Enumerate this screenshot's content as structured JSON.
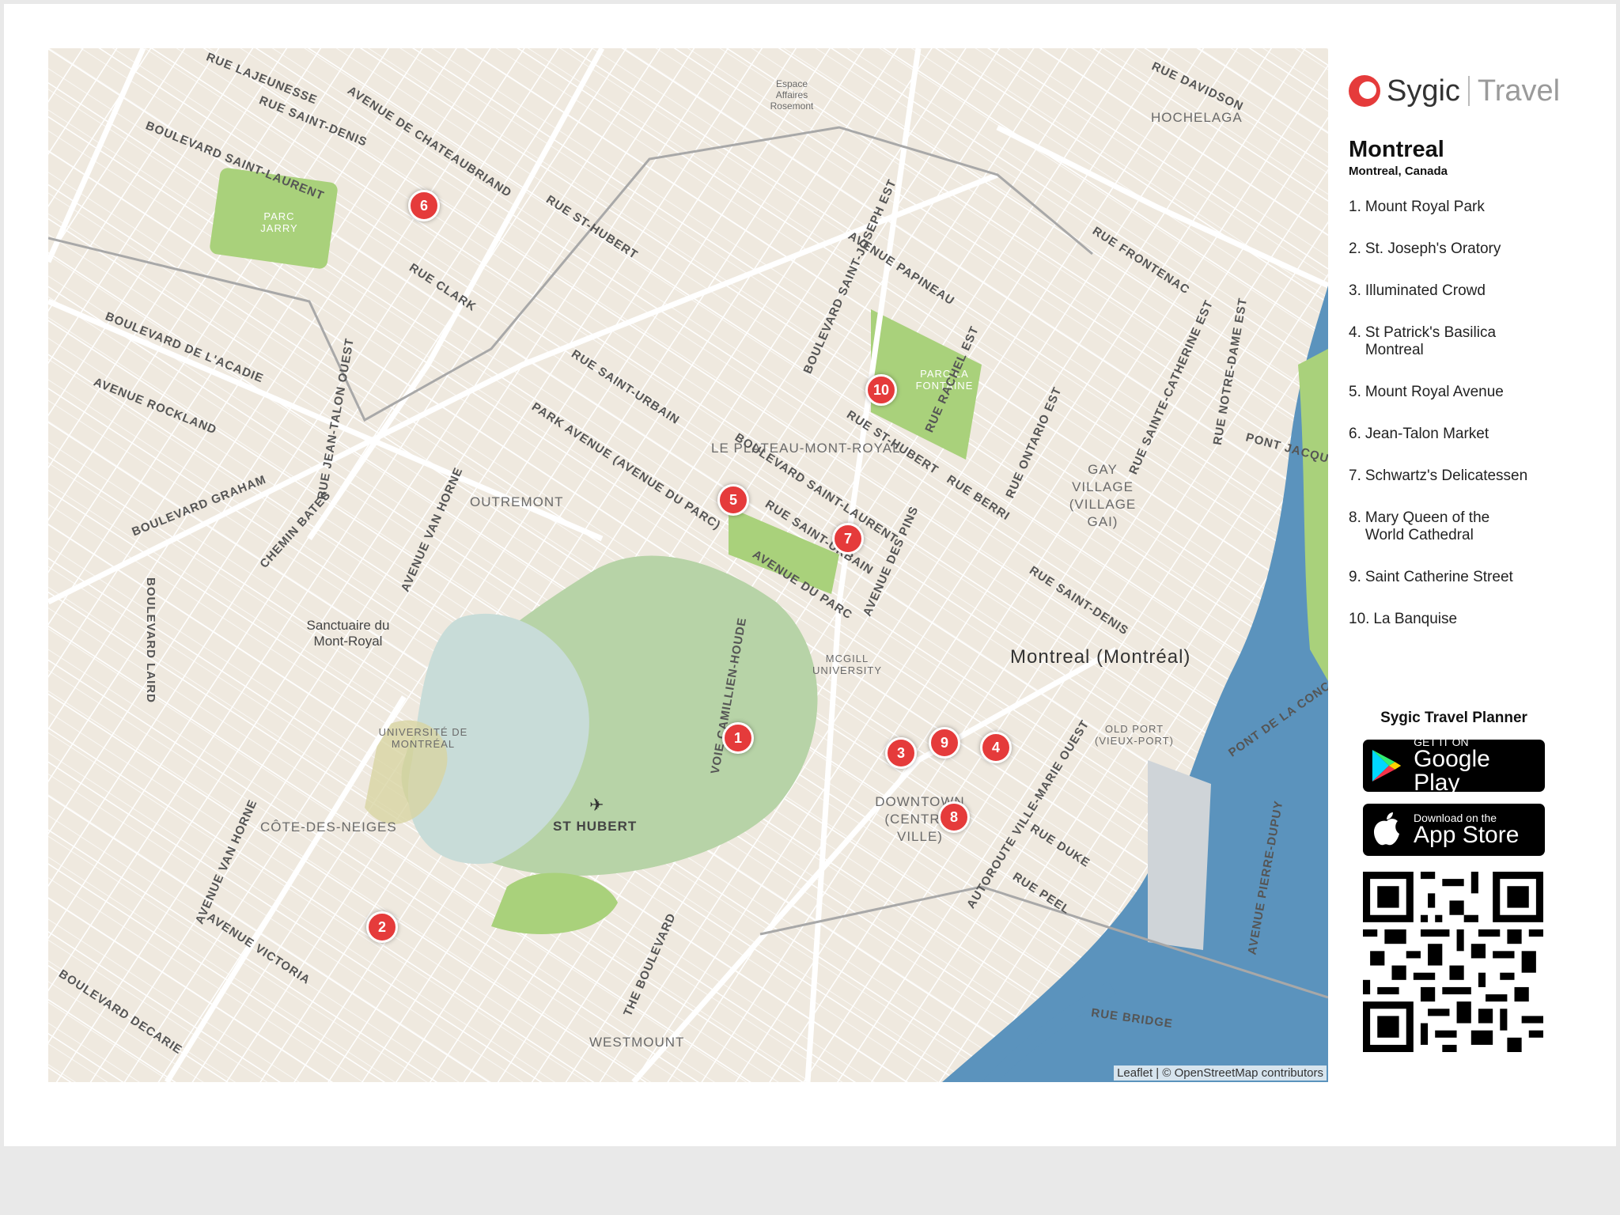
{
  "colors": {
    "land": "#efe9df",
    "water": "#5b93bd",
    "park": "#a9d17b",
    "mountain_park": "#b7d3a7",
    "street": "#ffffff",
    "marker": "#e53b3b",
    "brand_red": "#e53b3b"
  },
  "brand": {
    "name": "Sygic",
    "product": "Travel"
  },
  "map": {
    "title": "Montreal",
    "subtitle": "Montreal, Canada",
    "city_label": "Montreal (Montréal)",
    "attribution": "Leaflet | © OpenStreetMap contributors",
    "area_labels": {
      "plateau": "LE PLATEAU-MONT-ROYAL",
      "outremont": "OUTREMONT",
      "cote_des_neiges": "CÔTE-DES-NEIGES",
      "westmount": "WESTMOUNT",
      "downtown": "DOWNTOWN (CENTRE-VILLE)",
      "gay_village": "GAY VILLAGE (VILLAGE GAI)",
      "hochelaga": "HOCHELAGA",
      "st_hubert": "ST HUBERT",
      "parc_jarry": "PARC JARRY",
      "parc_lafontaine": "PARC LA FONTAINE",
      "mcgill": "MCGILL UNIVERSITY",
      "udem": "UNIVERSITÉ DE MONTRÉAL",
      "sanctuaire": "Sanctuaire du Mont-Royal",
      "old_port": "OLD PORT (VIEUX-PORT)",
      "espace": "Espace Affaires Rosemont"
    },
    "road_labels": {
      "lajeunesse": "RUE LAJEUNESSE",
      "saint_denis": "RUE SAINT-DENIS",
      "saint_laurent_n": "BOULEVARD SAINT-LAURENT",
      "chateaubriand": "AVENUE DE CHATEAUBRIAND",
      "st_hubert": "RUE ST-HUBERT",
      "clark": "RUE CLARK",
      "acadie": "BOULEVARD DE L'ACADIE",
      "rockland": "AVENUE ROCKLAND",
      "graham": "BOULEVARD GRAHAM",
      "st_joseph": "BOULEVARD SAINT-JOSEPH EST",
      "papineau": "AVENUE PAPINEAU",
      "frontenac": "RUE FRONTENAC",
      "davidson": "RUE DAVIDSON",
      "saint_urbain": "RUE SAINT-URBAIN",
      "park_avenue": "PARK AVENUE (AVENUE DU PARC)",
      "saint_laurent_s": "BOULEVARD SAINT-LAURENT",
      "avenue_du_parc": "AVENUE DU PARC",
      "pins": "AVENUE DES PINS",
      "berri": "RUE BERRI",
      "saint_denis_s": "RUE SAINT-DENIS",
      "duke": "RUE DUKE",
      "peel": "RUE PEEL",
      "bridge": "RUE BRIDGE",
      "van_horne": "AVENUE VAN HORNE",
      "victoria": "AVENUE VICTORIA",
      "decarie": "BOULEVARD DECARIE",
      "the_boulevard": "THE BOULEVARD",
      "camillien": "VOIE CAMILLIEN-HOUDE",
      "pont_jacques": "PONT JACQUES",
      "pont_concorde": "PONT DE LA CONC",
      "ville_marie": "AUTOROUTE VILLE-MARIE OUEST",
      "pierre_dupuy": "AVENUE PIERRE-DUPUY",
      "notre_dame": "RUE NOTRE-DAME EST",
      "sainte_catherine": "RUE SAINTE-CATHERINE EST",
      "ontario": "RUE ONTARIO EST",
      "rachel": "RUE RACHEL EST",
      "jean_talon": "RUE JEAN-TALON OUEST",
      "chemin_bates": "CHEMIN BATES",
      "laird": "BOULEVARD LAIRD"
    },
    "markers": [
      "1",
      "2",
      "3",
      "4",
      "5",
      "6",
      "7",
      "8",
      "9",
      "10"
    ]
  },
  "poi_list": [
    {
      "num": "1.",
      "name": "Mount Royal Park"
    },
    {
      "num": "2.",
      "name": "St. Joseph's Oratory"
    },
    {
      "num": "3.",
      "name": "Illuminated Crowd"
    },
    {
      "num": "4.",
      "name": "St Patrick's Basilica Montreal"
    },
    {
      "num": "5.",
      "name": "Mount Royal Avenue"
    },
    {
      "num": "6.",
      "name": "Jean-Talon Market"
    },
    {
      "num": "7.",
      "name": "Schwartz's Delicatessen"
    },
    {
      "num": "8.",
      "name": "Mary Queen of the World Cathedral"
    },
    {
      "num": "9.",
      "name": "Saint Catherine Street"
    },
    {
      "num": "10.",
      "name": "La Banquise"
    }
  ],
  "planner": {
    "title": "Sygic Travel Planner",
    "google_small": "GET IT ON",
    "google_big": "Google Play",
    "apple_small": "Download on the",
    "apple_big": "App Store"
  },
  "icons": {
    "airport": "airplane-icon",
    "google_play": "google-play-icon",
    "apple": "apple-icon",
    "qr": "qr-code-icon"
  }
}
